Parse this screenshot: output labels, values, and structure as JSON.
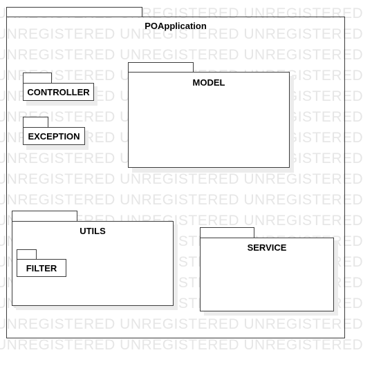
{
  "watermark": {
    "text": "UNREGISTERED UNREGISTERED UNREGISTERED"
  },
  "diagram": {
    "root": {
      "name": "POApplication"
    },
    "packages": {
      "controller": {
        "name": "CONTROLLER"
      },
      "exception": {
        "name": "EXCEPTION"
      },
      "model": {
        "name": "MODEL"
      },
      "utils": {
        "name": "UTILS",
        "children": {
          "filter": {
            "name": "FILTER"
          }
        }
      },
      "service": {
        "name": "SERVICE"
      }
    }
  }
}
